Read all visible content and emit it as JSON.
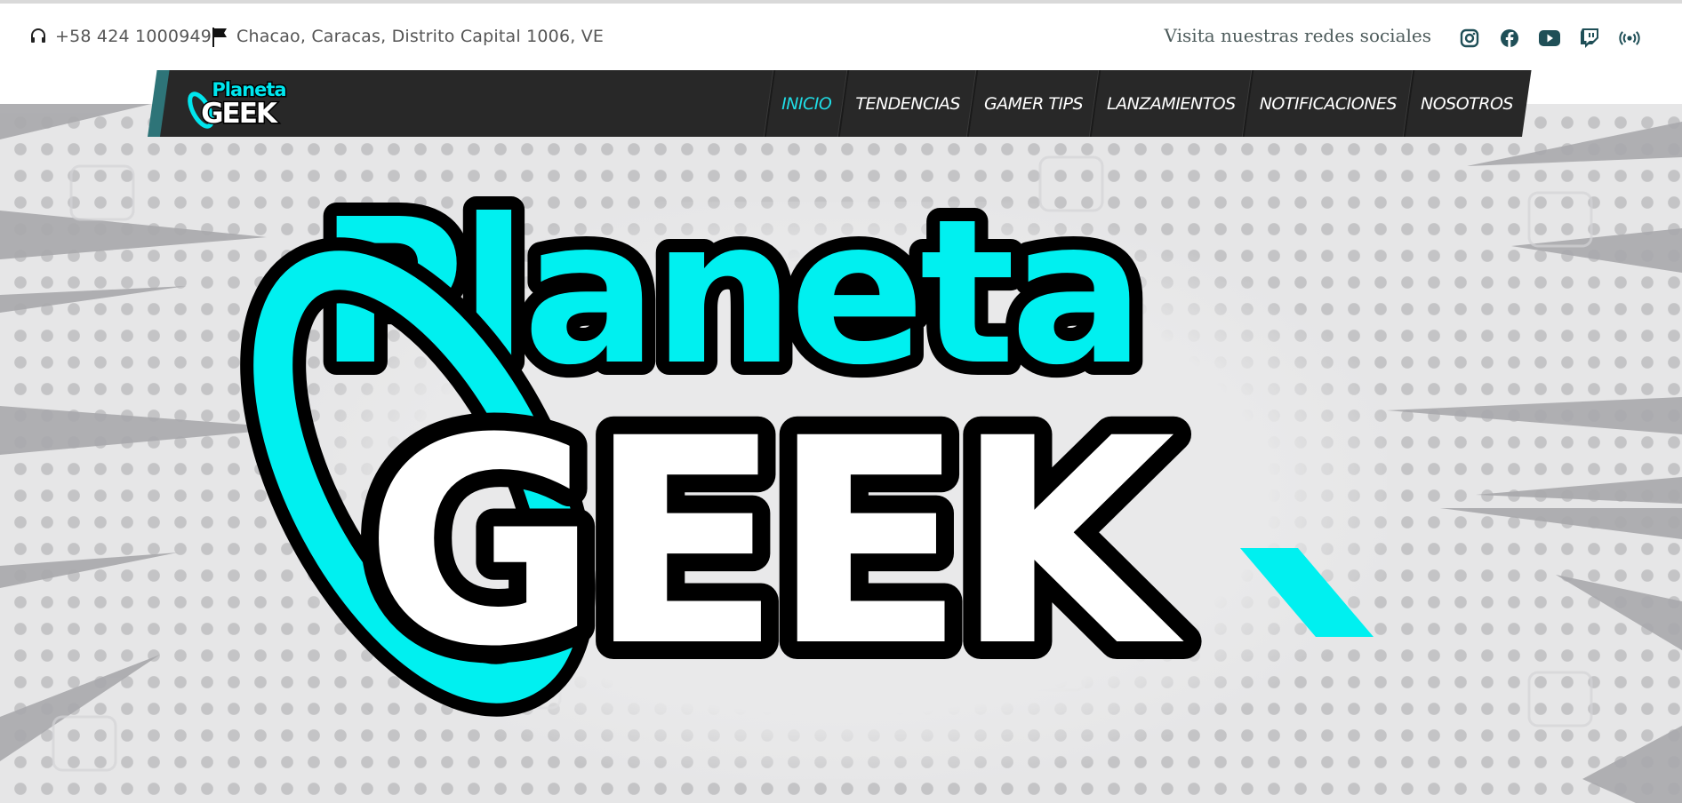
{
  "topbar": {
    "phone": "+58 424 1000949",
    "address": "Chacao, Caracas, Distrito Capital 1006, VE",
    "social_label": "Visita nuestras redes sociales",
    "social_icons": [
      "instagram-icon",
      "facebook-icon",
      "youtube-icon",
      "twitch-icon",
      "podcast-icon"
    ]
  },
  "nav": {
    "logo": {
      "line1": "Planeta",
      "line2": "GEEK"
    },
    "items": [
      {
        "label": "INICIO",
        "active": true
      },
      {
        "label": "TENDENCIAS",
        "active": false
      },
      {
        "label": "GAMER TIPS",
        "active": false
      },
      {
        "label": "LANZAMIENTOS",
        "active": false
      },
      {
        "label": "NOTIFICACIONES",
        "active": false
      },
      {
        "label": "NOSOTROS",
        "active": false
      }
    ]
  },
  "hero": {
    "logo": {
      "line1": "Planeta",
      "line2": "GEEK"
    }
  },
  "colors": {
    "accent": "#20dde6",
    "nav_bg": "#282828",
    "nav_accent": "#2e7478",
    "logo_cyan": "#00f0f0"
  }
}
